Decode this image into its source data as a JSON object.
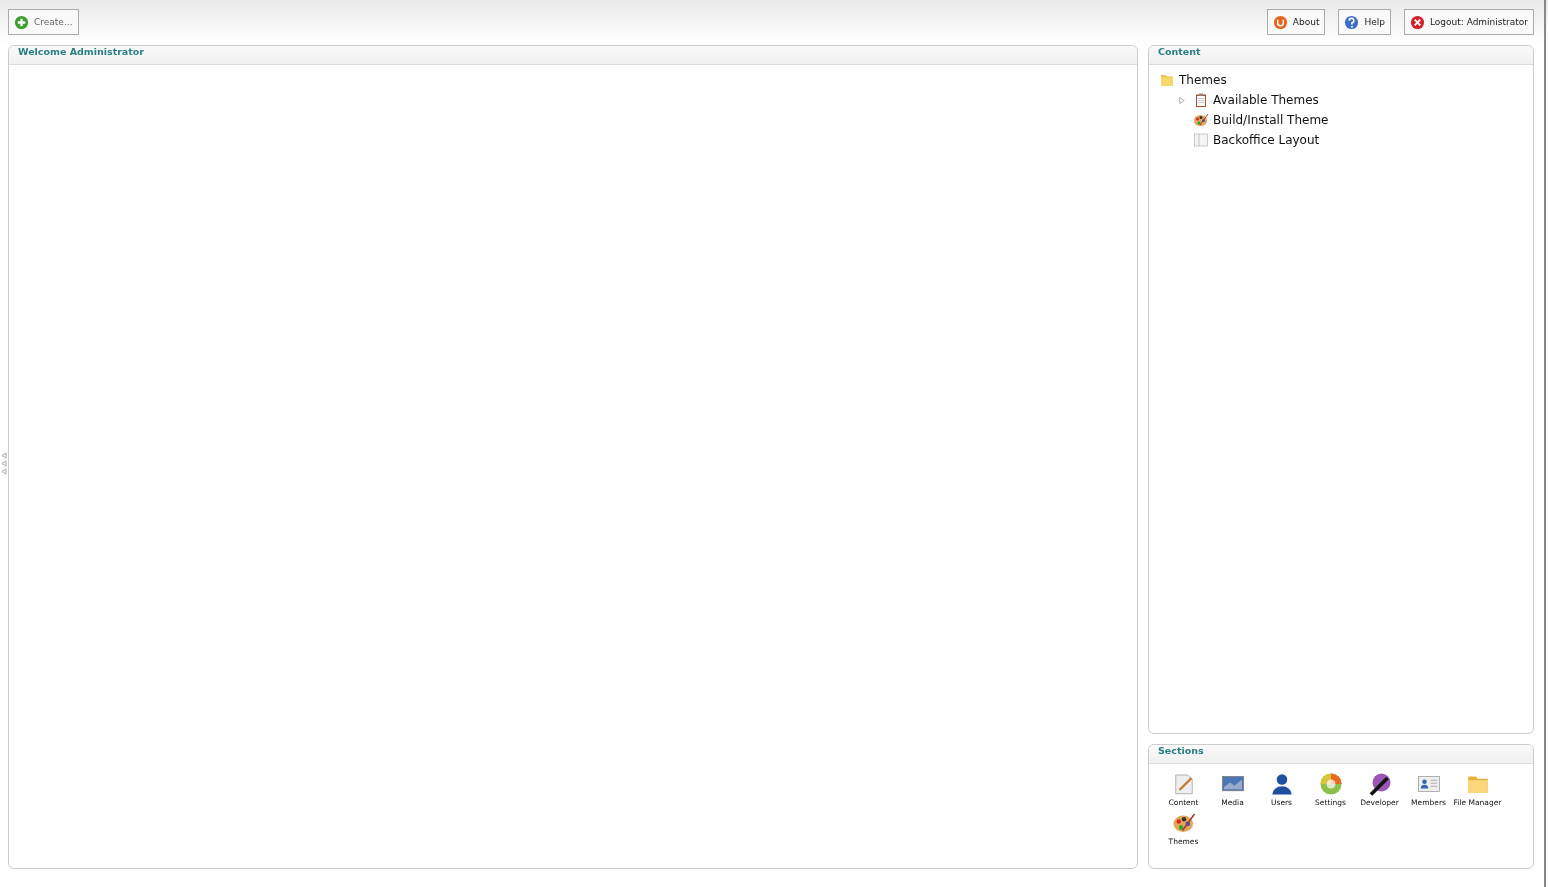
{
  "toolbar": {
    "create_button": "Create...",
    "buttons": [
      {
        "kind": "about",
        "label": "About"
      },
      {
        "kind": "help",
        "label": "Help"
      },
      {
        "kind": "logout",
        "label": "Logout: Administrator"
      }
    ]
  },
  "main_panel": {
    "title": "Welcome Administrator"
  },
  "content_panel": {
    "title": "Content",
    "tree": [
      {
        "label": "Themes",
        "kind": "folder",
        "children": [
          {
            "label": "Available Themes",
            "kind": "clipboard",
            "expandable": true
          },
          {
            "label": "Build/Install Theme",
            "kind": "palette",
            "expandable": false
          },
          {
            "label": "Backoffice Layout",
            "kind": "layout",
            "expandable": false
          }
        ]
      }
    ]
  },
  "sections_panel": {
    "title": "Sections",
    "items": [
      {
        "label": "Content",
        "kind": "content"
      },
      {
        "label": "Media",
        "kind": "media"
      },
      {
        "label": "Users",
        "kind": "users"
      },
      {
        "label": "Settings",
        "kind": "settings"
      },
      {
        "label": "Developer",
        "kind": "developer"
      },
      {
        "label": "Members",
        "kind": "members"
      },
      {
        "label": "File Manager",
        "kind": "files"
      },
      {
        "label": "Themes",
        "kind": "themes"
      }
    ]
  }
}
